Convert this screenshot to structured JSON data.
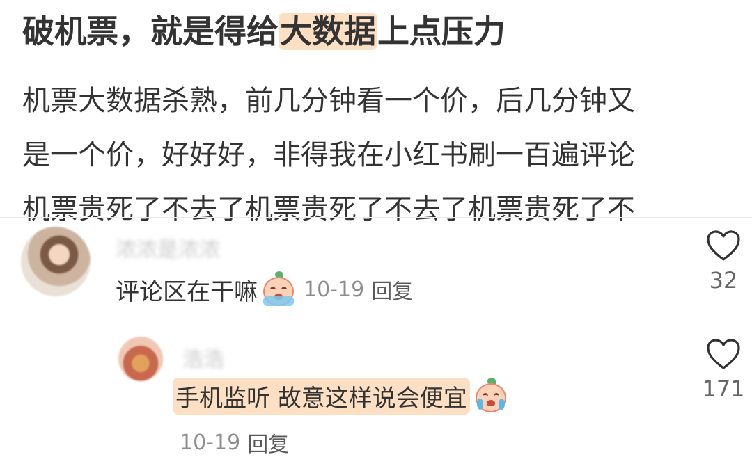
{
  "post": {
    "title_before": "破机票，就是得给",
    "title_highlight": "大数据",
    "title_after": "上点压力",
    "body_lines": [
      "机票大数据杀熟，前几分钟看一个价，后几分钟又",
      "是一个价，好好好，非得我在小红书刷一百遍评论",
      "机票贵死了不去了机票贵死了不去了机票贵死了不"
    ]
  },
  "comments": [
    {
      "username": "浓浓是浓浓",
      "text": "评论区在干嘛",
      "emoji": "crying-face-emoji",
      "date": "10-19",
      "reply_label": "回复",
      "likes": "32",
      "avatar": "avatar"
    },
    {
      "username": "浩浩",
      "text": "手机监听 故意这样说会便宜",
      "emoji": "crying-face-emoji",
      "date": "10-19",
      "reply_label": "回复",
      "likes": "171",
      "avatar": "avatar"
    }
  ],
  "colors": {
    "highlight": "#fde0c4",
    "text": "#333333",
    "meta": "#8c8c8c"
  }
}
